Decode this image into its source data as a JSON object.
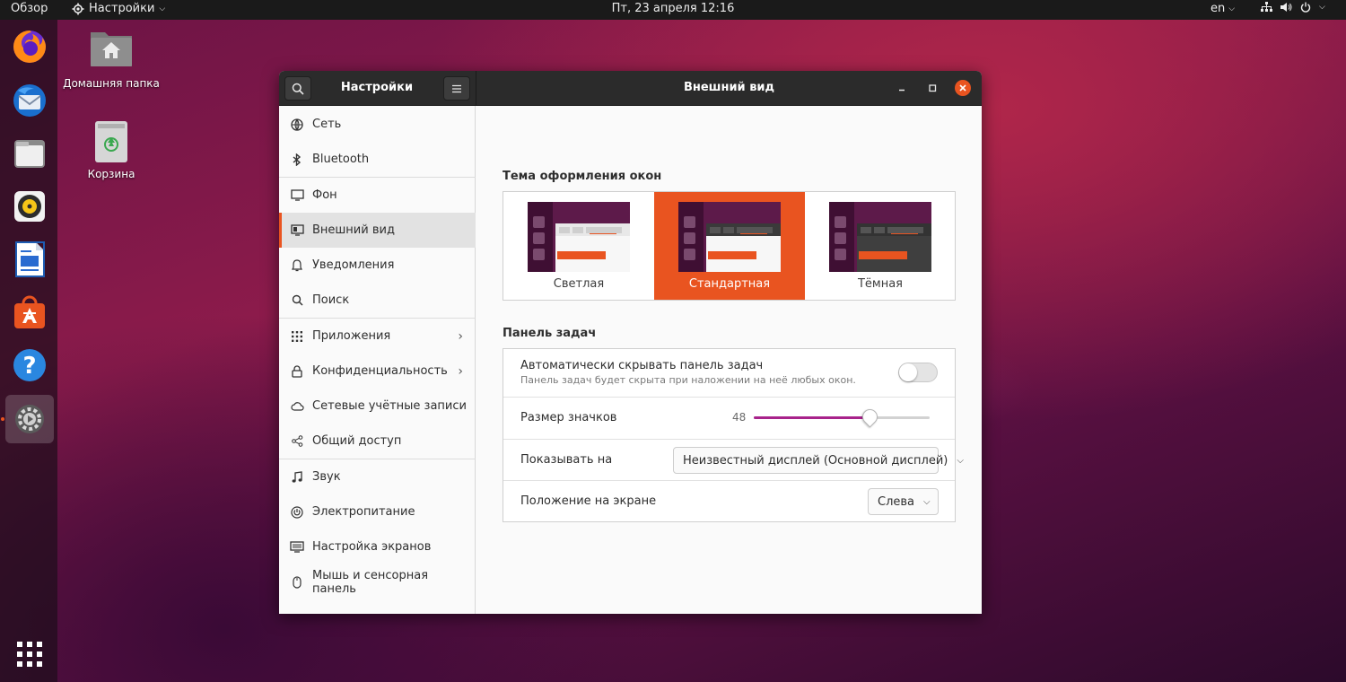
{
  "topbar": {
    "activities": "Обзор",
    "app_menu": "Настройки",
    "clock": "Пт, 23 апреля  12:16",
    "lang": "en"
  },
  "desktop": {
    "home_folder": "Домашняя папка",
    "trash": "Корзина"
  },
  "dock": {
    "items": [
      "firefox-icon",
      "thunderbird-icon",
      "files-icon",
      "rhythmbox-icon",
      "libreoffice-writer-icon",
      "ubuntu-software-icon",
      "help-icon",
      "settings-icon"
    ],
    "show_apps": "app-grid-icon"
  },
  "window": {
    "sidebar_title": "Настройки",
    "page_title": "Внешний вид"
  },
  "sidebar": {
    "items": [
      {
        "label": "Сеть",
        "icon": "network-icon"
      },
      {
        "label": "Bluetooth",
        "icon": "bluetooth-icon"
      },
      {
        "label": "Фон",
        "icon": "background-icon"
      },
      {
        "label": "Внешний вид",
        "icon": "appearance-icon"
      },
      {
        "label": "Уведомления",
        "icon": "bell-icon"
      },
      {
        "label": "Поиск",
        "icon": "search-icon"
      },
      {
        "label": "Приложения",
        "icon": "apps-grid-icon"
      },
      {
        "label": "Конфиденциальность",
        "icon": "privacy-icon"
      },
      {
        "label": "Сетевые учётные записи",
        "icon": "cloud-icon"
      },
      {
        "label": "Общий доступ",
        "icon": "share-icon"
      },
      {
        "label": "Звук",
        "icon": "music-note-icon"
      },
      {
        "label": "Электропитание",
        "icon": "power-icon"
      },
      {
        "label": "Настройка экранов",
        "icon": "display-icon"
      },
      {
        "label": "Мышь и сенсорная панель",
        "icon": "mouse-icon"
      }
    ],
    "active": "Внешний вид"
  },
  "appearance": {
    "theme_section": "Тема оформления окон",
    "themes": [
      "Светлая",
      "Стандартная",
      "Тёмная"
    ],
    "selected_theme": "Стандартная",
    "dock_section": "Панель задач",
    "autohide_label": "Автоматически скрывать панель задач",
    "autohide_sub": "Панель задач будет скрыта при наложении на неё любых окон.",
    "autohide_enabled": false,
    "icon_size_label": "Размер значков",
    "icon_size_value": "48",
    "icon_size_fraction": 0.66,
    "show_on_label": "Показывать на",
    "show_on_value": "Неизвестный дисплей (Основной дисплей)",
    "position_label": "Положение на экране",
    "position_value": "Слева"
  },
  "colors": {
    "accent": "#e95420",
    "slider": "#a8238b",
    "headerbar": "#2b2b2b"
  }
}
